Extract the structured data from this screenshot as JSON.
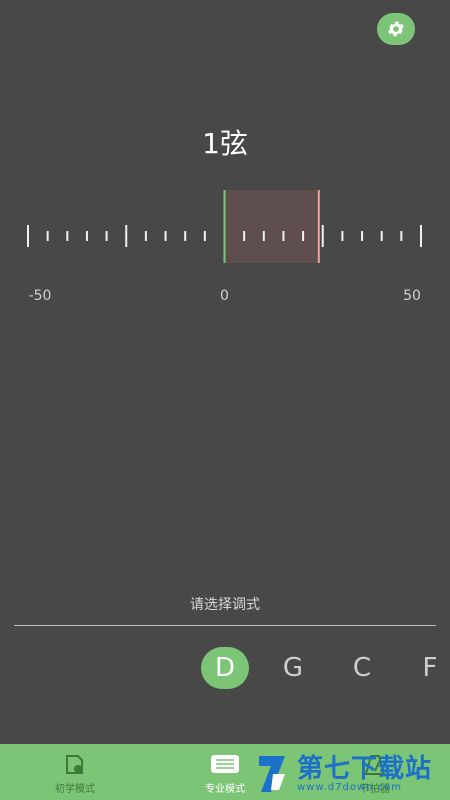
{
  "header": {
    "settings_icon": "gear-icon"
  },
  "tuner": {
    "string_label": "1弦",
    "scale_labels": [
      "-50",
      "0",
      "50"
    ],
    "scale_min": -50,
    "scale_max": 50,
    "needle_value": 24,
    "colors": {
      "center_line": "#7cc576",
      "needle": "#f0a0a0",
      "highlight": "#5e4e4e",
      "ticks": "#f0f0f0"
    }
  },
  "tuning": {
    "prompt": "请选择调式",
    "notes": [
      "D",
      "G",
      "C",
      "F"
    ],
    "selected_note": "D"
  },
  "bottom_nav": {
    "items": [
      {
        "label": "初学模式",
        "icon": "beginner-icon",
        "active": false
      },
      {
        "label": "专业模式",
        "icon": "keyboard-icon",
        "active": true
      },
      {
        "label": "节拍器",
        "icon": "metronome-icon",
        "active": false
      }
    ],
    "color": "#7cc576"
  },
  "watermark": {
    "text": "第七下载站",
    "sub": "www.d7down.com"
  }
}
